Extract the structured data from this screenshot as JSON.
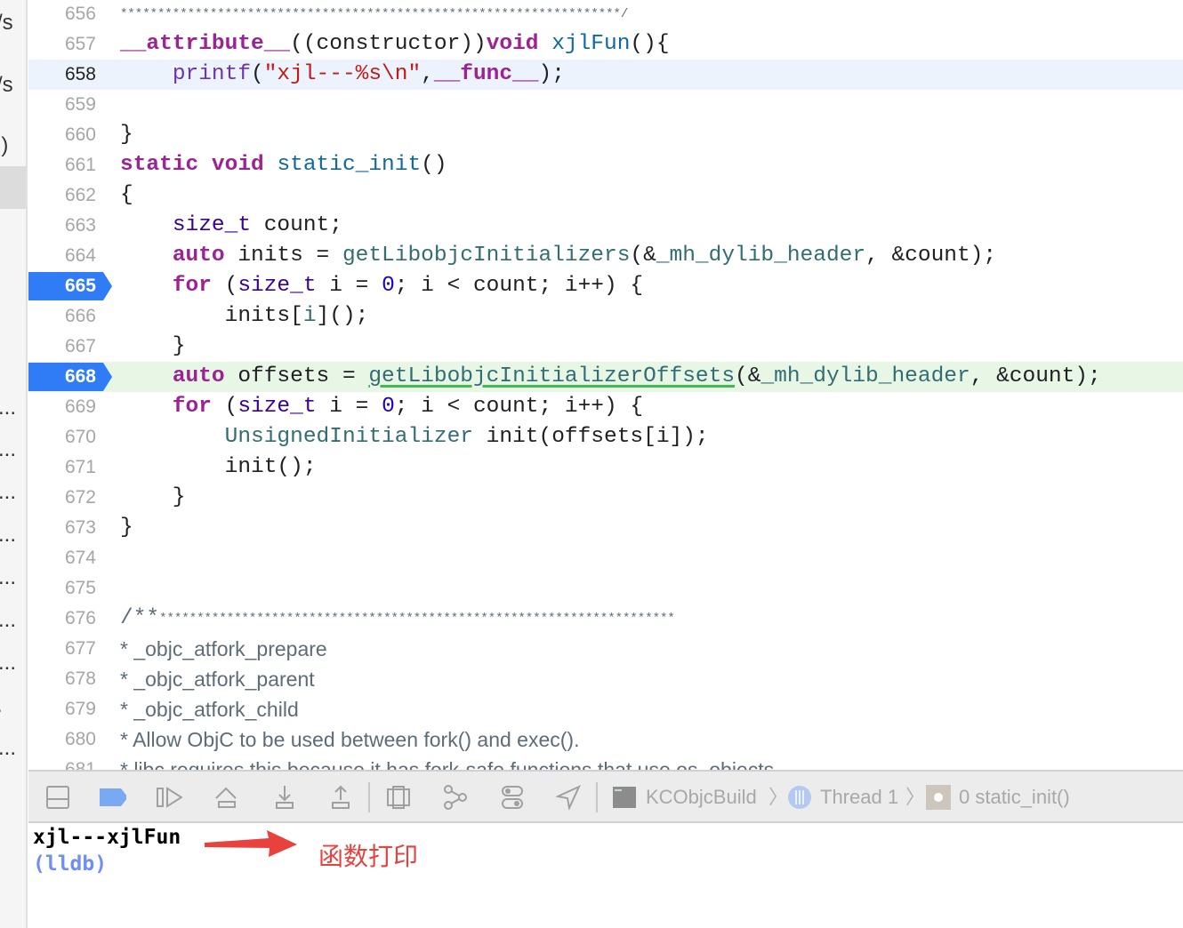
{
  "sidebar": {
    "fragments": [
      "/s",
      "/s",
      "l)",
      "...",
      "...",
      "...",
      "...",
      "...",
      "...",
      "...",
      ".",
      "..."
    ]
  },
  "editor": {
    "lines": [
      {
        "n": "656",
        "tokens": [
          [
            "c",
            "*******************************************************************/"
          ]
        ],
        "stars": true
      },
      {
        "n": "657",
        "tokens": [
          [
            "k",
            "__attribute__"
          ],
          [
            "p",
            "((constructor))"
          ],
          [
            "k",
            "void"
          ],
          [
            "p",
            " "
          ],
          [
            "f",
            "xjlFun"
          ],
          [
            "p",
            "(){"
          ]
        ]
      },
      {
        "n": "658",
        "cur": true,
        "tokens": [
          [
            "p",
            "    "
          ],
          [
            "sys",
            "printf"
          ],
          [
            "p",
            "("
          ],
          [
            "str",
            "\"xjl---%s\\n\""
          ],
          [
            "p",
            ","
          ],
          [
            "k",
            "__func__"
          ],
          [
            "p",
            ");"
          ]
        ]
      },
      {
        "n": "659",
        "tokens": []
      },
      {
        "n": "660",
        "tokens": [
          [
            "p",
            "}"
          ]
        ]
      },
      {
        "n": "661",
        "tokens": [
          [
            "k",
            "static"
          ],
          [
            "p",
            " "
          ],
          [
            "k",
            "void"
          ],
          [
            "p",
            " "
          ],
          [
            "f",
            "static_init"
          ],
          [
            "p",
            "()"
          ]
        ]
      },
      {
        "n": "662",
        "tokens": [
          [
            "p",
            "{"
          ]
        ]
      },
      {
        "n": "663",
        "tokens": [
          [
            "p",
            "    "
          ],
          [
            "t",
            "size_t"
          ],
          [
            "p",
            " count;"
          ]
        ]
      },
      {
        "n": "664",
        "tokens": [
          [
            "p",
            "    "
          ],
          [
            "k",
            "auto"
          ],
          [
            "p",
            " inits = "
          ],
          [
            "s",
            "getLibobjcInitializers"
          ],
          [
            "p",
            "(&"
          ],
          [
            "s",
            "_mh_dylib_header"
          ],
          [
            "p",
            ", &count);"
          ]
        ]
      },
      {
        "n": "665",
        "bp": true,
        "tokens": [
          [
            "p",
            "    "
          ],
          [
            "k",
            "for"
          ],
          [
            "p",
            " ("
          ],
          [
            "t",
            "size_t"
          ],
          [
            "p",
            " i = "
          ],
          [
            "n",
            "0"
          ],
          [
            "p",
            "; i < count; i++) {"
          ]
        ]
      },
      {
        "n": "666",
        "tokens": [
          [
            "p",
            "        inits["
          ],
          [
            "s",
            "i"
          ],
          [
            "p",
            "]();"
          ]
        ]
      },
      {
        "n": "667",
        "tokens": [
          [
            "p",
            "    }"
          ]
        ]
      },
      {
        "n": "668",
        "bp": true,
        "pc": true,
        "tokens": [
          [
            "p",
            "    "
          ],
          [
            "k",
            "auto"
          ],
          [
            "p",
            " offsets = "
          ],
          [
            "s u",
            "getLibobjcInitializerOffsets"
          ],
          [
            "p",
            "(&"
          ],
          [
            "s",
            "_mh_dylib_header"
          ],
          [
            "p",
            ", &count);"
          ]
        ]
      },
      {
        "n": "669",
        "tokens": [
          [
            "p",
            "    "
          ],
          [
            "k",
            "for"
          ],
          [
            "p",
            " ("
          ],
          [
            "t",
            "size_t"
          ],
          [
            "p",
            " i = "
          ],
          [
            "n",
            "0"
          ],
          [
            "p",
            "; i < count; i++) {"
          ]
        ]
      },
      {
        "n": "670",
        "tokens": [
          [
            "p",
            "        "
          ],
          [
            "s",
            "UnsignedInitializer"
          ],
          [
            "p",
            " init(offsets[i]);"
          ]
        ]
      },
      {
        "n": "671",
        "tokens": [
          [
            "p",
            "        init();"
          ]
        ]
      },
      {
        "n": "672",
        "tokens": [
          [
            "p",
            "    }"
          ]
        ]
      },
      {
        "n": "673",
        "tokens": [
          [
            "p",
            "}"
          ]
        ]
      },
      {
        "n": "674",
        "tokens": []
      },
      {
        "n": "675",
        "tokens": []
      },
      {
        "n": "676",
        "tokens": [
          [
            "c",
            "/**"
          ],
          [
            "stars",
            "*********************************************************************"
          ]
        ]
      },
      {
        "n": "677",
        "prose": true,
        "tokens": [
          [
            "c",
            "* _objc_atfork_prepare"
          ]
        ]
      },
      {
        "n": "678",
        "prose": true,
        "tokens": [
          [
            "c",
            "* _objc_atfork_parent"
          ]
        ]
      },
      {
        "n": "679",
        "prose": true,
        "tokens": [
          [
            "c",
            "* _objc_atfork_child"
          ]
        ]
      },
      {
        "n": "680",
        "prose": true,
        "tokens": [
          [
            "c",
            "* Allow ObjC to be used between fork() and exec()."
          ]
        ]
      },
      {
        "n": "681",
        "prose": true,
        "tokens": [
          [
            "c",
            "* libc requires this because it has fork-safe functions that use os_objects."
          ]
        ]
      }
    ]
  },
  "toolbar": {
    "icons": [
      "hide-debug-area-icon",
      "breakpoints-toggle-icon",
      "continue-icon",
      "step-over-icon",
      "step-into-icon",
      "step-out-icon",
      "view-hierarchy-icon",
      "memory-graph-icon",
      "environment-overrides-icon",
      "simulate-location-icon"
    ],
    "process": "KCObjcBuild",
    "thread": "Thread 1",
    "frame": "0 static_init()",
    "accent": "#2f7cf6"
  },
  "console": {
    "output": "xjl---xjlFun",
    "prompt": "(lldb)",
    "annotation": "函数打印",
    "annotation_color": "#e8413e"
  }
}
